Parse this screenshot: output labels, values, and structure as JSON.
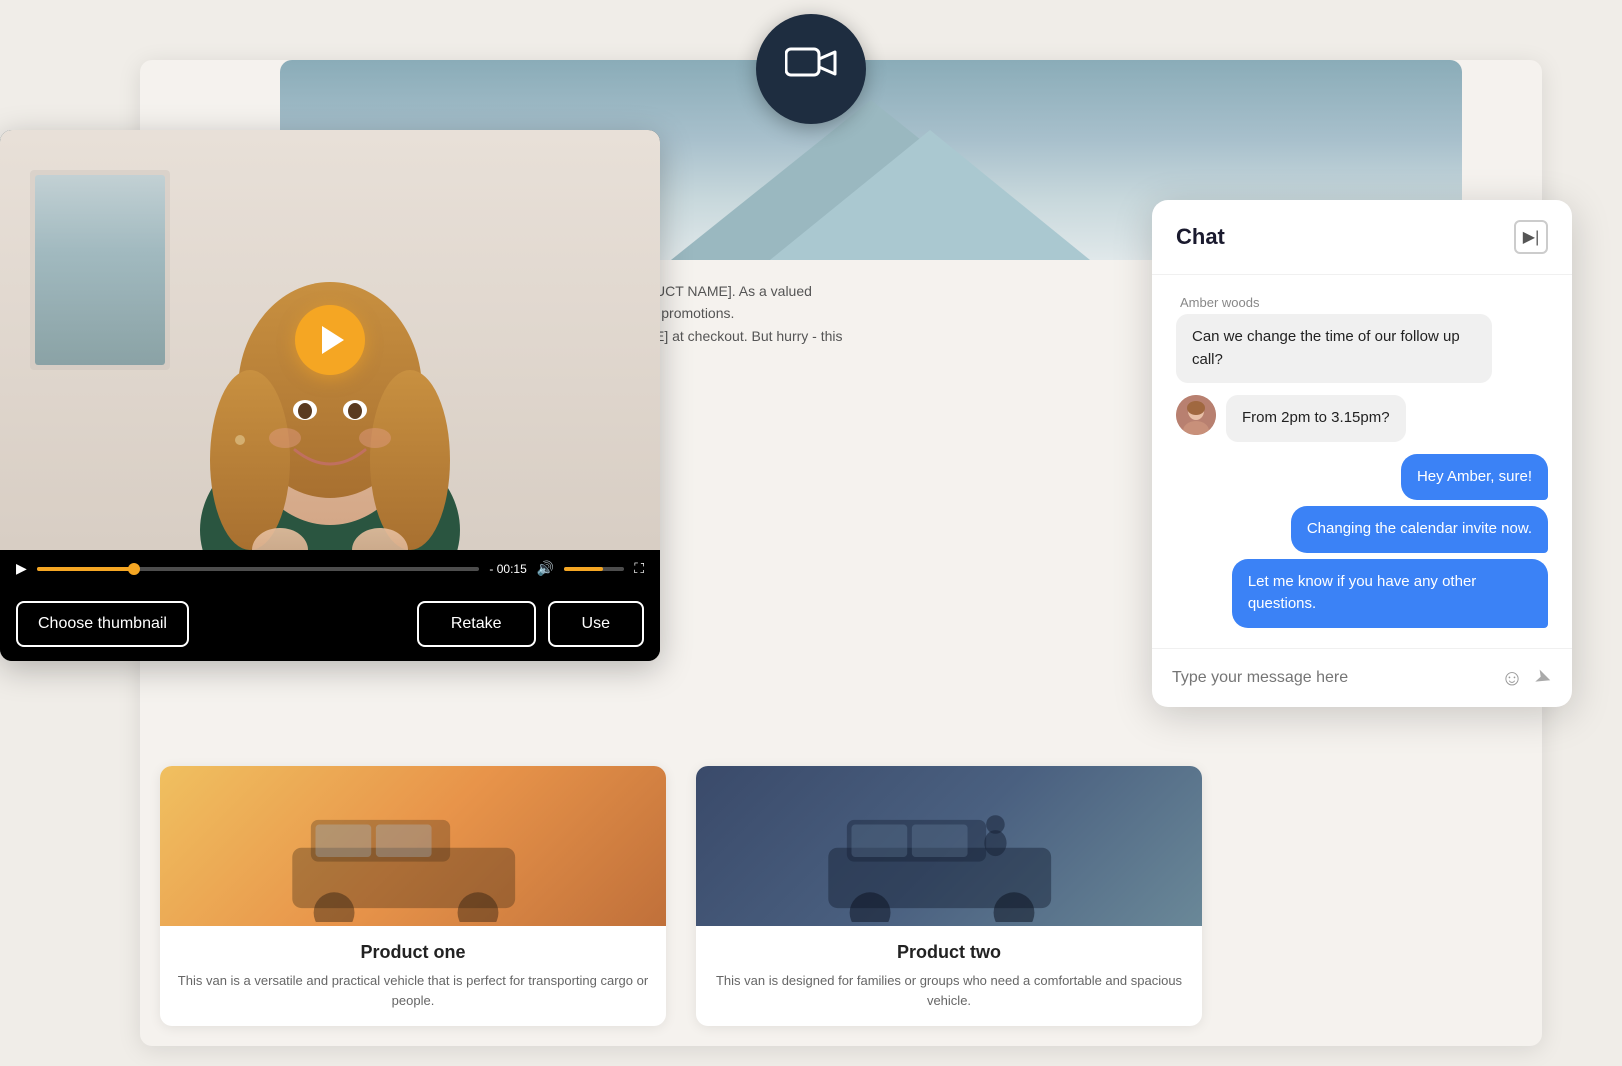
{
  "video_icon": {
    "label": "Video camera icon"
  },
  "video_player": {
    "time_display": "- 00:15",
    "progress_percent": 22,
    "volume_percent": 65,
    "buttons": {
      "choose_thumbnail": "Choose thumbnail",
      "retake": "Retake",
      "use": "Use"
    }
  },
  "background_text": {
    "line1": "[RODUCT NAME].  As a valued",
    "line2": "ls and promotions.",
    "line3": "[CODE]  at checkout. But hurry - this"
  },
  "products": [
    {
      "title": "Product one",
      "description": "This van is a versatile and practical vehicle that is perfect for transporting cargo or people.",
      "image_color_class": "card1"
    },
    {
      "title": "Product two",
      "description": "This van is designed for families or groups who need a comfortable and spacious vehicle.",
      "image_color_class": "card2"
    }
  ],
  "chat": {
    "title": "Chat",
    "collapse_icon": "▶",
    "sender_name": "Amber woods",
    "received_messages": [
      "Can we change the time of our follow up call?",
      "From 2pm to 3.15pm?"
    ],
    "sent_messages": [
      "Hey Amber, sure!",
      "Changing the calendar invite now.",
      "Let me know if you have any other questions."
    ],
    "input_placeholder": "Type your message here",
    "emoji_icon": "☺",
    "send_icon": "➤"
  }
}
